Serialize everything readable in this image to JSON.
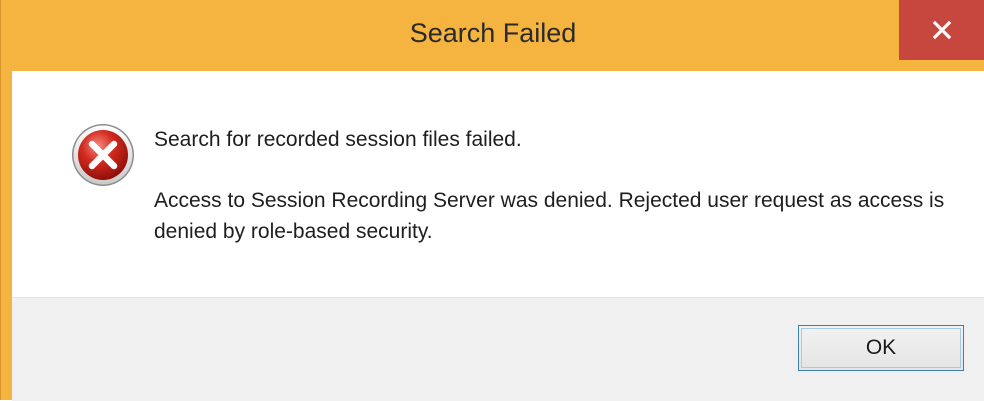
{
  "dialog": {
    "title": "Search Failed",
    "main_instruction": "Search for recorded session files failed.",
    "detail": "Access to Session Recording Server was denied. Rejected user request as access is denied by role-based security.",
    "ok_label": "OK",
    "icon": "error-icon"
  },
  "colors": {
    "frame": "#f5b33f",
    "close_button": "#c7463d",
    "footer": "#f0f0f0",
    "button_border": "#3c7fb1"
  }
}
